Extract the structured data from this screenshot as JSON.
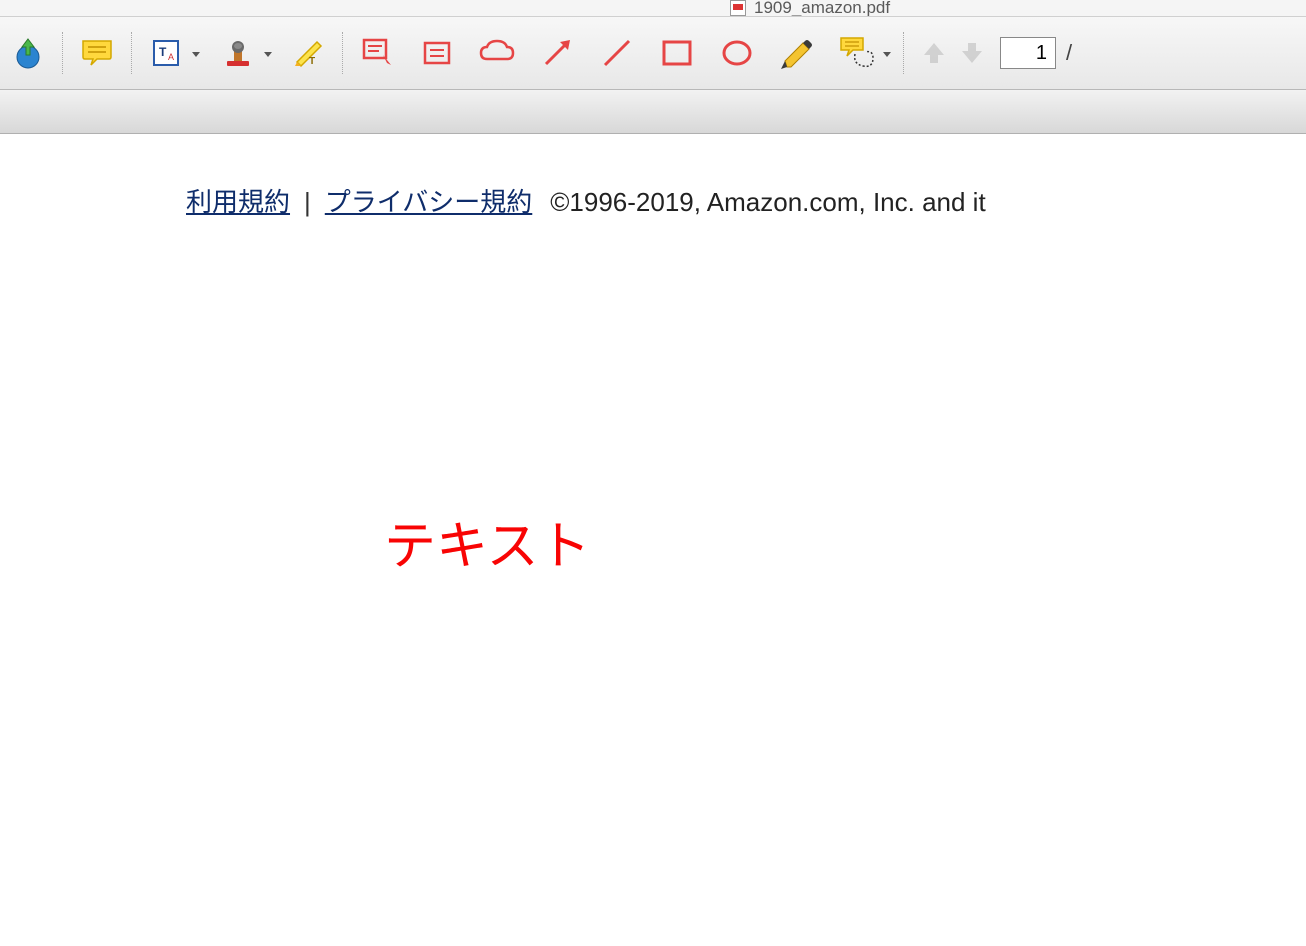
{
  "tab": {
    "filename": "1909_amazon.pdf"
  },
  "toolbar": {
    "share_icon": "share-icon",
    "note_icon": "note-icon",
    "text_markup_icon": "text-markup-icon",
    "stamp_icon": "stamp-icon",
    "highlighter_icon": "highlighter-icon",
    "textbox_icon": "textbox-icon",
    "callout_icon": "callout-icon",
    "cloud_icon": "cloud-icon",
    "arrow_icon": "arrow-icon",
    "line_icon": "line-icon",
    "rectangle_icon": "rectangle-icon",
    "oval_icon": "oval-icon",
    "pencil_icon": "pencil-icon",
    "lasso_note_icon": "lasso-note-icon",
    "page_up_icon": "page-up-icon",
    "page_down_icon": "page-down-icon",
    "page_number": "1",
    "page_separator": "/"
  },
  "document": {
    "footer": {
      "terms_link": "利用規約 ",
      "divider": "|",
      "privacy_link": "プライバシー規約",
      "copyright": "©1996-2019, Amazon.com, Inc. and it"
    },
    "annotation_text": "テキスト"
  }
}
